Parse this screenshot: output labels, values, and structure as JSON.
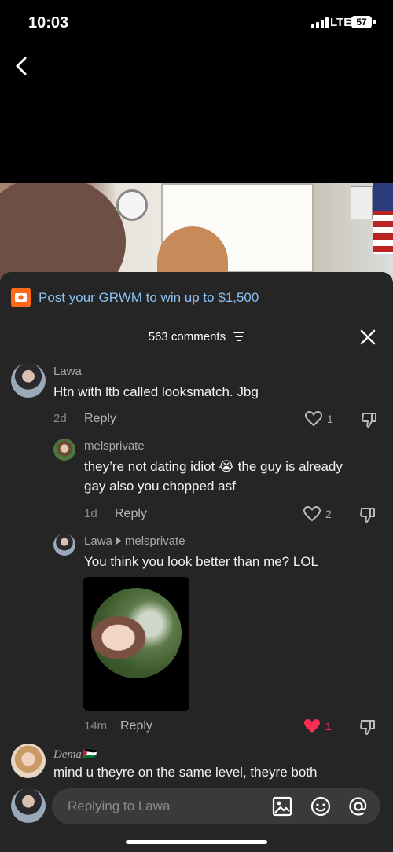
{
  "status": {
    "time": "10:03",
    "network": "LTE",
    "battery": "57"
  },
  "promo": {
    "text": "Post your GRWM to win up to $1,500"
  },
  "comments_header": {
    "count_label": "563 comments"
  },
  "comments": [
    {
      "user": "Lawa",
      "text": "Htn with ltb called looksmatch. Jbg",
      "age": "2d",
      "reply_label": "Reply",
      "likes": "1"
    },
    {
      "user": "melsprivate",
      "text_line1": "they’re not dating idiot 😭 the guy is already",
      "text_line2": "gay also you chopped asf",
      "age": "1d",
      "reply_label": "Reply",
      "likes": "2"
    },
    {
      "user": "Lawa",
      "reply_to": "melsprivate",
      "text": "You think you look better than me? LOL",
      "age": "14m",
      "reply_label": "Reply",
      "likes": "1",
      "liked_color": "#fe2c55"
    },
    {
      "user": "Dema🇵🇸",
      "text": "mind u theyre on the same level, theyre both"
    }
  ],
  "composer": {
    "placeholder": "Replying to Lawa"
  },
  "icons": {
    "back": "chevron-left-icon",
    "promo": "camera-icon",
    "filter": "sort-filter-icon",
    "close": "close-icon",
    "like": "heart-icon",
    "dislike": "thumbs-down-icon",
    "image": "image-icon",
    "emoji": "emoji-icon",
    "mention": "at-icon"
  }
}
